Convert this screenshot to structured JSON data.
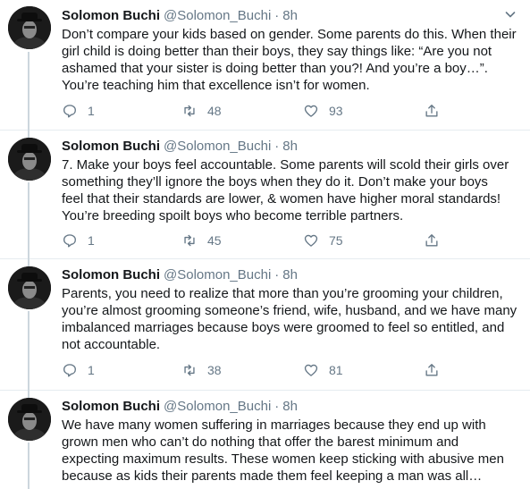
{
  "tweets": [
    {
      "name": "Solomon Buchi",
      "handle": "@Solomon_Buchi",
      "separator": "·",
      "time": "8h",
      "text": "Don’t compare your kids based on gender. Some parents do this. When their\ngirl child is doing better than their boys, they say things like: “Are you not\nashamed that your sister is doing better than you?! And you’re a boy…”.\nYou’re teaching him that excellence isn’t for women.",
      "replies": "1",
      "retweets": "48",
      "likes": "93"
    },
    {
      "name": "Solomon Buchi",
      "handle": "@Solomon_Buchi",
      "separator": "·",
      "time": "8h",
      "text": "7. Make your boys feel accountable. Some parents will scold their girls over\nsomething they’ll ignore the boys when they do it. Don’t make your boys\nfeel that their standards are lower, & women have higher moral standards!\nYou’re breeding spoilt boys who become terrible partners.",
      "replies": "1",
      "retweets": "45",
      "likes": "75"
    },
    {
      "name": "Solomon Buchi",
      "handle": "@Solomon_Buchi",
      "separator": "·",
      "time": "8h",
      "text": "Parents, you need to realize that more than you’re grooming your children,\nyou’re almost grooming someone’s friend, wife, husband, and we have many\nimbalanced marriages because boys were groomed to feel so entitled, and\nnot accountable.",
      "replies": "1",
      "retweets": "38",
      "likes": "81"
    },
    {
      "name": "Solomon Buchi",
      "handle": "@Solomon_Buchi",
      "separator": "·",
      "time": "8h",
      "text": "We have many women suffering in marriages because they end up with\ngrown men who can’t do nothing that offer the barest minimum and\nexpecting maximum results. These women keep sticking with abusive men\nbecause as kids their parents made them feel keeping a man was all…"
    }
  ],
  "icons": {
    "reply": "reply-icon",
    "retweet": "retweet-icon",
    "like": "heart-icon",
    "share": "share-icon",
    "caret": "chevron-down-icon"
  },
  "colors": {
    "text": "#14171a",
    "muted": "#657786",
    "thread_line": "#ccd6dd",
    "divider": "#e6ecf0"
  }
}
